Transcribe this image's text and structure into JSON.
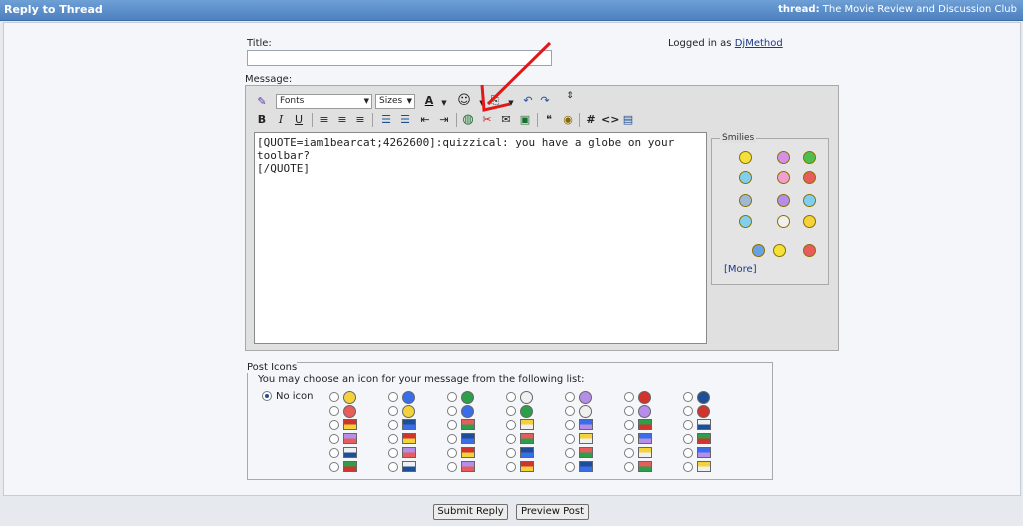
{
  "header": {
    "title": "Reply to Thread",
    "thread_label": "thread:",
    "thread_name": "The Movie Review and Discussion Club"
  },
  "form": {
    "title_label": "Title:",
    "title_value": "",
    "logged_in_prefix": "Logged in as",
    "username": "DjMethod",
    "message_label": "Message:",
    "message_text": "[QUOTE=iam1bearcat;4262600]:quizzical: you have a globe on your toolbar?\n[/QUOTE]"
  },
  "toolbar": {
    "font_select": "Fonts",
    "size_select": "Sizes"
  },
  "smilies": {
    "legend": "Smilies",
    "more": "[More]",
    "colors": [
      "#f3e03a",
      "#d68ee8",
      "#4cc04c",
      "#7fd0f0",
      "#f0a0d0",
      "#e85c5c",
      "#9fb8d8",
      "#b48ee8",
      "#7fd0f0",
      "#7fd0f0",
      "#f0f0f0",
      "#f3d23a",
      "#6aa0e8",
      "#f3e03a",
      "#e85c5c"
    ]
  },
  "post_icons": {
    "legend": "Post Icons",
    "instruction": "You may choose an icon for your message from the following list:",
    "no_icon": "No icon"
  },
  "buttons": {
    "submit": "Submit Reply",
    "preview": "Preview Post"
  },
  "colors": {
    "header_bg": "#4c80bf",
    "arrow": "#e01818"
  }
}
